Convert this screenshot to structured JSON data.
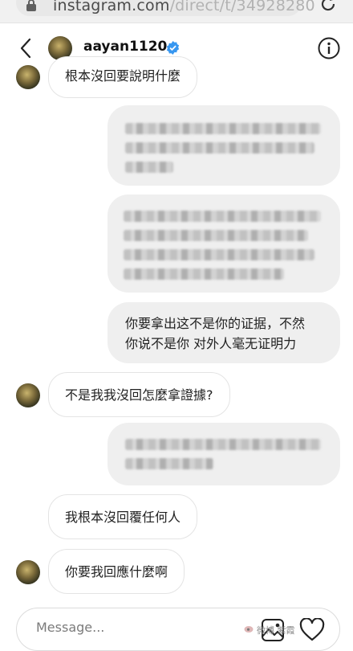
{
  "browser": {
    "url_host": "instagram.com",
    "url_path": "/direct/t/34928280"
  },
  "header": {
    "username": "aayan1120"
  },
  "messages": {
    "m1": {
      "text": "根本沒回要說明什麼"
    },
    "m4_line1": "你要拿出这不是你的证据，不然",
    "m4_line2": "你说不是你 对外人毫无证明力",
    "m5": {
      "text": "不是我我沒回怎麼拿證據?"
    },
    "m7": {
      "text": "我根本沒回覆任何人"
    },
    "m8": {
      "text": "你要我回應什麼啊"
    }
  },
  "composer": {
    "placeholder": "Message..."
  },
  "watermark": {
    "text": "微博 紫霞"
  },
  "colors": {
    "incoming_bubble": "#ffffff",
    "outgoing_bubble": "#efefef",
    "verified_blue": "#3897f0"
  },
  "icons": [
    "lock-icon",
    "reload-icon",
    "back-icon",
    "verified-icon",
    "info-icon",
    "image-icon",
    "heart-icon",
    "avatar"
  ]
}
